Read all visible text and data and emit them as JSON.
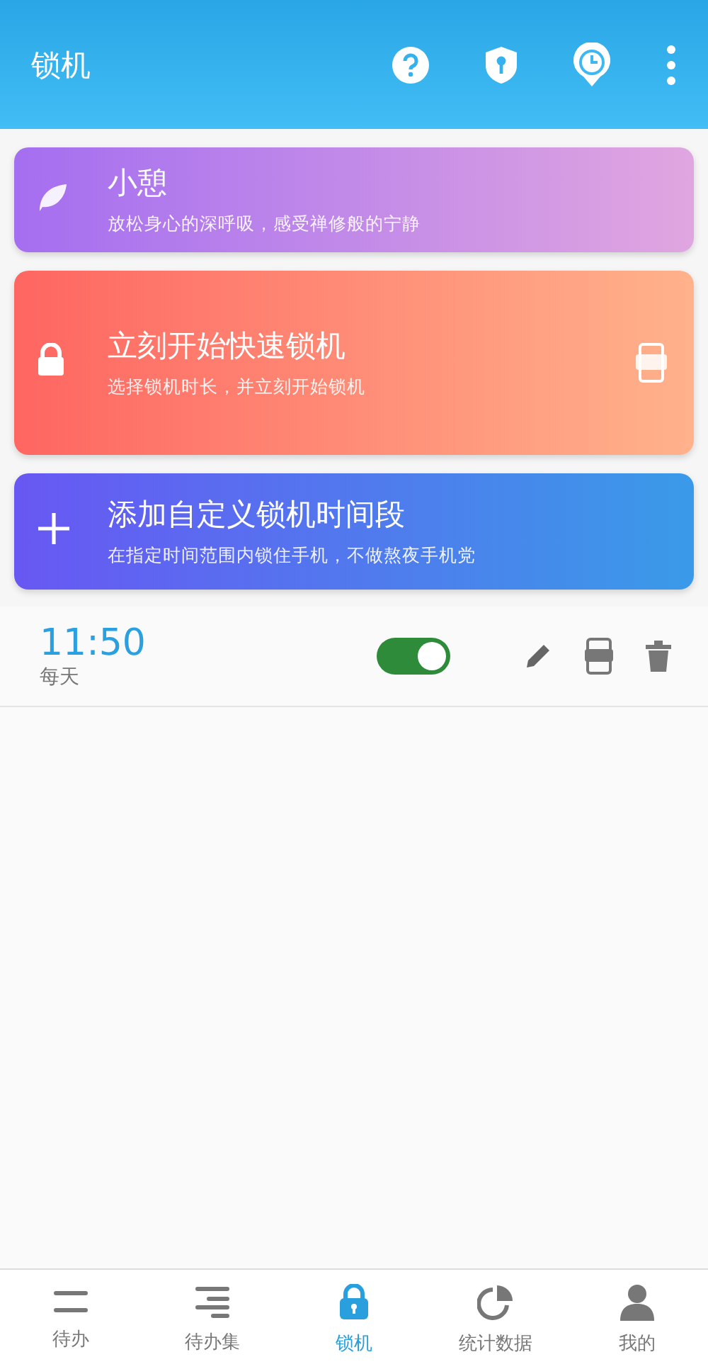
{
  "app_bar": {
    "title": "锁机"
  },
  "cards": [
    {
      "kind": "break",
      "title": "小憩",
      "subtitle": "放松身心的深呼吸，感受禅修般的宁静",
      "app_badge": false
    },
    {
      "kind": "quick",
      "title": "立刻开始快速锁机",
      "subtitle": "选择锁机时长，并立刻开始锁机",
      "app_badge": true
    },
    {
      "kind": "custom",
      "title": "添加自定义锁机时间段",
      "subtitle": "在指定时间范围内锁住手机，不做熬夜手机党",
      "app_badge": false
    }
  ],
  "schedules": [
    {
      "time": "11:50",
      "repeat": "每天",
      "on": true
    }
  ],
  "tabs": [
    {
      "kind": "todo",
      "label": "待办",
      "selected": false
    },
    {
      "kind": "sets",
      "label": "待办集",
      "selected": false
    },
    {
      "kind": "lock",
      "label": "锁机",
      "selected": true
    },
    {
      "kind": "stats",
      "label": "统计数据",
      "selected": false
    },
    {
      "kind": "me",
      "label": "我的",
      "selected": false
    }
  ]
}
